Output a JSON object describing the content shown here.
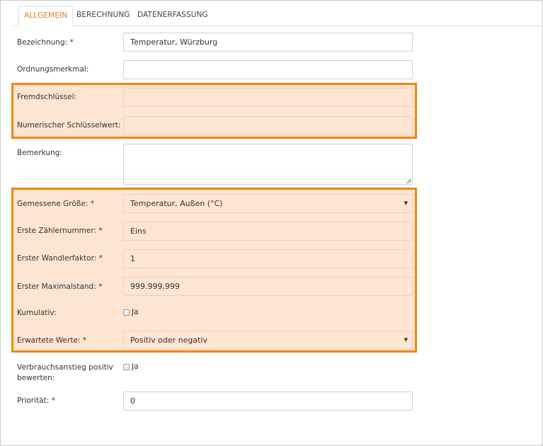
{
  "tabs": [
    "ALLGEMEIN",
    "BERECHNUNG",
    "DATENERFASSUNG"
  ],
  "form": {
    "bezeichnung": {
      "label": "Bezeichnung: *",
      "value": "Temperatur, Würzburg"
    },
    "ordnungsmerkmal": {
      "label": "Ordnungsmerkmal:",
      "value": ""
    },
    "fremdschluessel": {
      "label": "Fremdschlüssel:",
      "value": ""
    },
    "numerischer_schluesselwert": {
      "label": "Numerischer Schlüsselwert:",
      "value": ""
    },
    "bemerkung": {
      "label": "Bemerkung:",
      "value": ""
    },
    "gemessene_groesse": {
      "label": "Gemessene Größe: *",
      "value": "Temperatur, Außen (°C)"
    },
    "erste_zaehlernummer": {
      "label": "Erste Zählernummer: *",
      "value": "Eins"
    },
    "erster_wandlerfaktor": {
      "label": "Erster Wandlerfaktor: *",
      "value": "1"
    },
    "erster_maximalstand": {
      "label": "Erster Maximalstand: *",
      "value": "999.999,999"
    },
    "kumulativ": {
      "label": "Kumulativ:",
      "checkbox_label": "Ja",
      "checked": false
    },
    "erwartete_werte": {
      "label": "Erwartete Werte: *",
      "value": "Positiv oder negativ"
    },
    "verbrauchsanstieg": {
      "label_line1": "Verbrauchsanstieg positiv",
      "label_line2": "bewerten:",
      "checkbox_label": "Ja",
      "checked": false
    },
    "prioritaet": {
      "label": "Priorität: *",
      "value": "0"
    }
  },
  "colors": {
    "accent": "#e67e22",
    "highlight_border": "#f0860f",
    "highlight_fill": "#fde5d1"
  }
}
